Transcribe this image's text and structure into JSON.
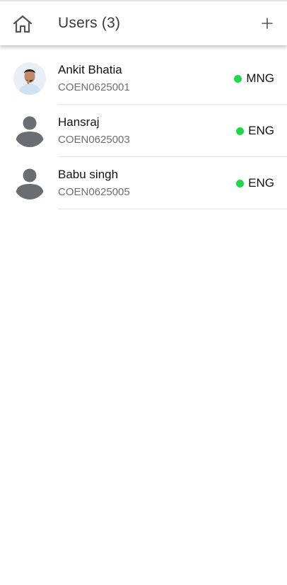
{
  "header": {
    "title": "Users (3)",
    "home_icon": "home-icon",
    "add_icon": "plus-icon"
  },
  "colors": {
    "status_dot": "#22d64a",
    "generic_avatar": "#6b6d72"
  },
  "users": [
    {
      "name": "Ankit Bhatia",
      "code": "COEN0625001",
      "role": "MNG",
      "avatar": "photo"
    },
    {
      "name": "Hansraj",
      "code": "COEN0625003",
      "role": "ENG",
      "avatar": "person-icon"
    },
    {
      "name": "Babu singh",
      "code": "COEN0625005",
      "role": "ENG",
      "avatar": "person-icon"
    }
  ]
}
